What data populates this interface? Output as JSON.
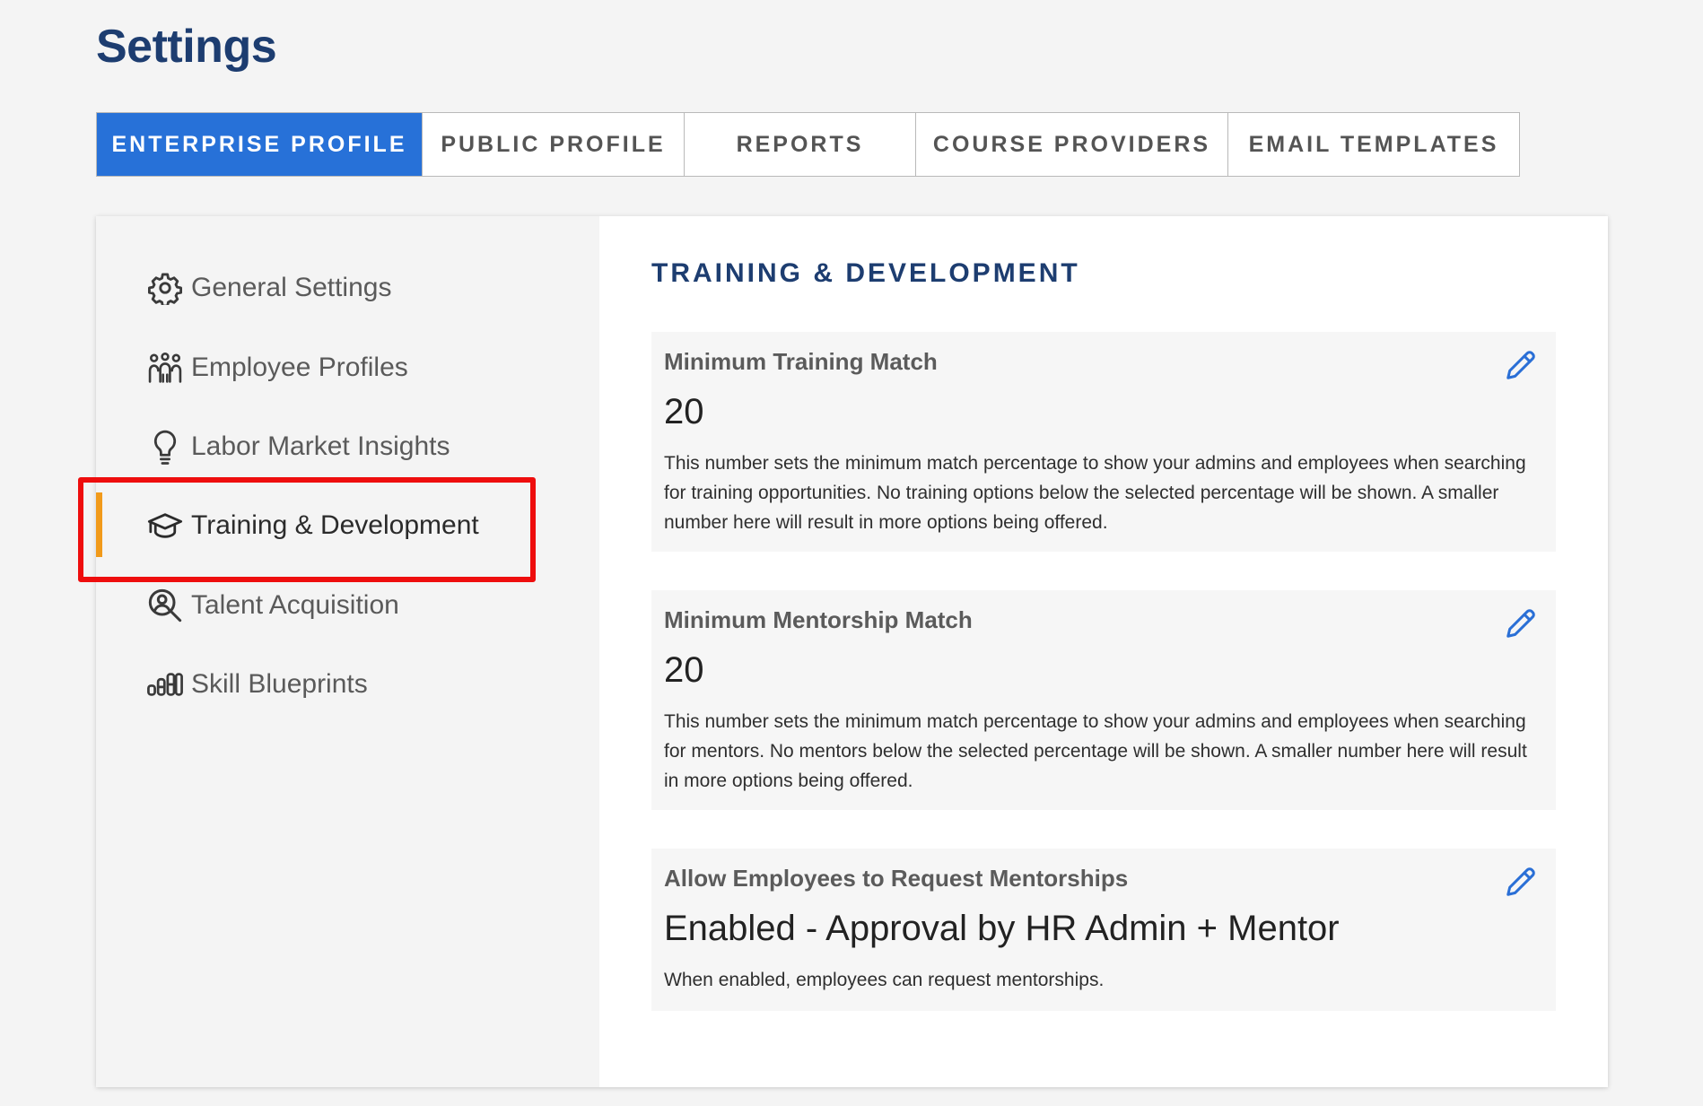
{
  "page": {
    "title": "Settings"
  },
  "tabs": [
    {
      "label": "ENTERPRISE PROFILE",
      "active": true
    },
    {
      "label": "PUBLIC PROFILE",
      "active": false
    },
    {
      "label": "REPORTS",
      "active": false
    },
    {
      "label": "COURSE PROVIDERS",
      "active": false
    },
    {
      "label": "EMAIL TEMPLATES",
      "active": false
    }
  ],
  "sidebar": {
    "items": [
      {
        "label": "General Settings",
        "icon": "gear-icon"
      },
      {
        "label": "Employee Profiles",
        "icon": "people-icon"
      },
      {
        "label": "Labor Market Insights",
        "icon": "lightbulb-icon"
      },
      {
        "label": "Training & Development",
        "icon": "graduation-cap-icon",
        "active": true
      },
      {
        "label": "Talent Acquisition",
        "icon": "person-search-icon"
      },
      {
        "label": "Skill Blueprints",
        "icon": "bar-levels-icon"
      }
    ]
  },
  "content": {
    "section_title": "TRAINING & DEVELOPMENT",
    "settings": [
      {
        "label": "Minimum Training Match",
        "value": "20",
        "description": "This number sets the minimum match percentage to show your admins and employees when searching for training opportunities. No training options below the selected percentage will be shown. A smaller number here will result in more options being offered."
      },
      {
        "label": "Minimum Mentorship Match",
        "value": "20",
        "description": "This number sets the minimum match percentage to show your admins and employees when searching for mentors. No mentors below the selected percentage will be shown. A smaller number here will result in more options being offered."
      },
      {
        "label": "Allow Employees to Request Mentorships",
        "value": "Enabled - Approval by HR Admin + Mentor",
        "description": "When enabled, employees can request mentorships."
      }
    ]
  },
  "colors": {
    "primary_blue": "#2771d8",
    "heading_navy": "#1d3d70",
    "active_bar_orange": "#f19a1a",
    "highlight_red": "#ee0d0d",
    "edit_icon_blue": "#2a6fd6"
  }
}
